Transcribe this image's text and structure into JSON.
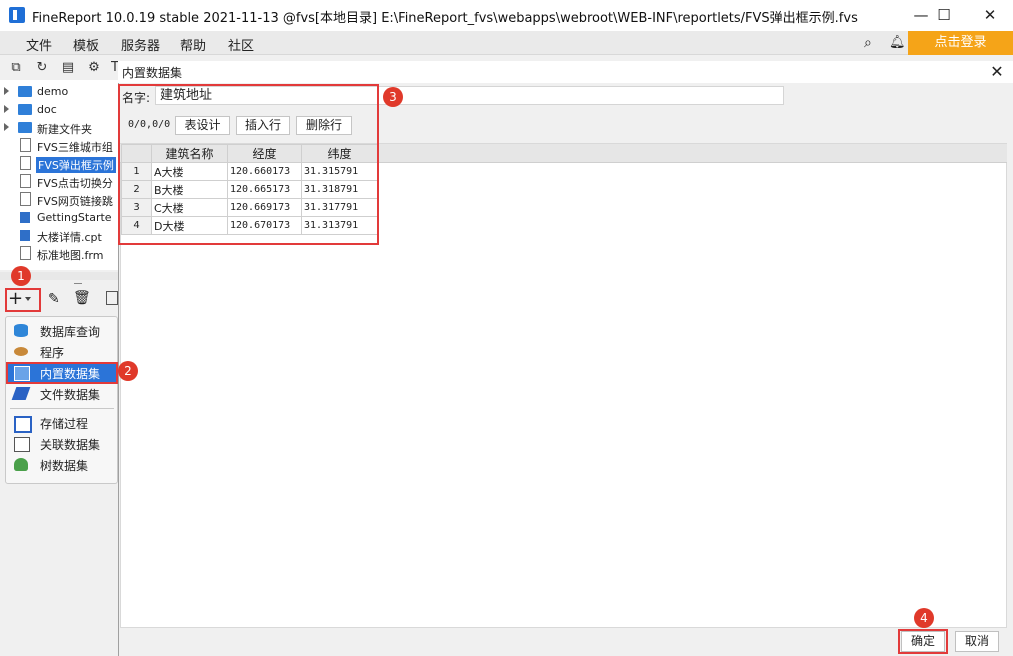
{
  "window": {
    "title": "FineReport 10.0.19 stable 2021-11-13 @fvs[本地目录]    E:\\FineReport_fvs\\webapps\\webroot\\WEB-INF\\reportlets/FVS弹出框示例.fvs",
    "minimize": "—",
    "maximize": "☐",
    "close": "✕"
  },
  "menu": {
    "items": [
      "文件",
      "模板",
      "服务器",
      "帮助",
      "社区"
    ],
    "login": "点击登录"
  },
  "tree": {
    "items": [
      {
        "label": "demo",
        "type": "folder"
      },
      {
        "label": "doc",
        "type": "folder"
      },
      {
        "label": "新建文件夹",
        "type": "folder"
      },
      {
        "label": "FVS三维城市组",
        "type": "file"
      },
      {
        "label": "FVS弹出框示例",
        "type": "file",
        "selected": true
      },
      {
        "label": "FVS点击切换分",
        "type": "file"
      },
      {
        "label": "FVS网页链接跳",
        "type": "file"
      },
      {
        "label": "GettingStarte",
        "type": "cpt"
      },
      {
        "label": "大楼详情.cpt",
        "type": "cpt"
      },
      {
        "label": "标准地图.frm",
        "type": "frm"
      }
    ]
  },
  "datasource_menu": {
    "add_button": "+",
    "items": [
      {
        "label": "数据库查询",
        "icon": "database-icon"
      },
      {
        "label": "程序",
        "icon": "program-icon"
      },
      {
        "label": "内置数据集",
        "icon": "embedded-dataset-icon",
        "selected": true
      },
      {
        "label": "文件数据集",
        "icon": "file-dataset-icon"
      },
      {
        "label": "存储过程",
        "icon": "stored-procedure-icon"
      },
      {
        "label": "关联数据集",
        "icon": "relation-dataset-icon"
      },
      {
        "label": "树数据集",
        "icon": "tree-dataset-icon"
      }
    ]
  },
  "dialog": {
    "title": "内置数据集",
    "name_label": "名字:",
    "name_value": "建筑地址",
    "position": "0/0,0/0",
    "buttons": {
      "design": "表设计",
      "insert_row": "插入行",
      "delete_row": "删除行"
    },
    "table": {
      "columns": [
        "建筑名称",
        "经度",
        "纬度"
      ],
      "rows": [
        [
          "1",
          "A大楼",
          "120.660173",
          "31.315791"
        ],
        [
          "2",
          "B大楼",
          "120.665173",
          "31.318791"
        ],
        [
          "3",
          "C大楼",
          "120.669173",
          "31.317791"
        ],
        [
          "4",
          "D大楼",
          "120.670173",
          "31.313791"
        ]
      ]
    },
    "ok": "确定",
    "cancel": "取消"
  },
  "annotations": [
    "1",
    "2",
    "3",
    "4"
  ],
  "colors": {
    "accent_orange": "#f5a418",
    "annotation_red": "#e23a3a",
    "selection_blue": "#2b74d8"
  }
}
